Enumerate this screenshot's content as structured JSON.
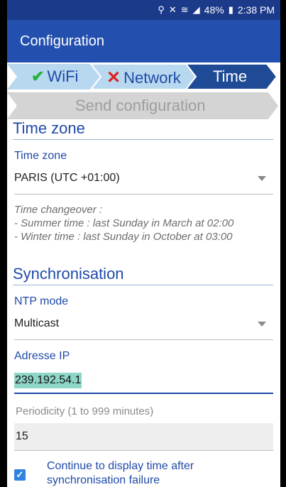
{
  "status_bar": {
    "icons": [
      "location-icon",
      "mute-vibrate-icon",
      "wifi-icon",
      "signal-icon",
      "battery-icon"
    ],
    "battery": "48%",
    "time": "2:38 PM"
  },
  "app_bar": {
    "title": "Configuration"
  },
  "steps": {
    "wifi": {
      "label": "WiFi",
      "state": "done",
      "color": "#b8d8ef"
    },
    "network": {
      "label": "Network",
      "state": "error",
      "color": "#b8d8ef"
    },
    "time": {
      "label": "Time",
      "state": "current",
      "color": "#1e4a96"
    },
    "send": {
      "label": "Send configuration",
      "state": "pending",
      "color": "#d4d4d4"
    }
  },
  "time_zone": {
    "section_title": "Time zone",
    "field_label": "Time zone",
    "selected": "PARIS (UTC +01:00)",
    "note_heading": "Time changeover :",
    "note_lines": [
      " - Summer time : last Sunday in March at 02:00",
      " - Winter time : last Sunday in October at 03:00"
    ]
  },
  "synchronisation": {
    "section_title": "Synchronisation",
    "ntp_label": "NTP mode",
    "ntp_value": "Multicast",
    "ip_label": "Adresse IP",
    "ip_value": "239.192.54.1",
    "period_label": "Periodicity (1 to 999 minutes)",
    "period_value": "15",
    "continue_checked": true,
    "continue_line1": "Continue to display time after",
    "continue_line2": "synchronisation failure"
  }
}
